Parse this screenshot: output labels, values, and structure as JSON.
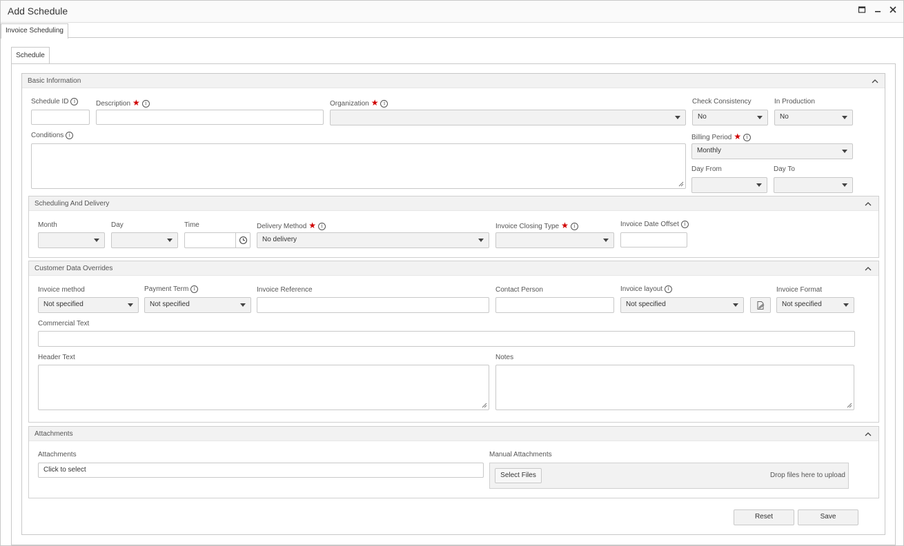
{
  "window": {
    "title": "Add Schedule"
  },
  "tabs": {
    "outer": "Invoice Scheduling",
    "inner": "Schedule"
  },
  "basic": {
    "header": "Basic Information",
    "schedule_id_label": "Schedule ID",
    "description_label": "Description",
    "organization_label": "Organization",
    "check_consistency_label": "Check Consistency",
    "check_consistency_value": "No",
    "in_production_label": "In Production",
    "in_production_value": "No",
    "conditions_label": "Conditions",
    "billing_period_label": "Billing Period",
    "billing_period_value": "Monthly",
    "day_from_label": "Day From",
    "day_to_label": "Day To"
  },
  "scheduling": {
    "header": "Scheduling And Delivery",
    "month_label": "Month",
    "day_label": "Day",
    "time_label": "Time",
    "delivery_method_label": "Delivery Method",
    "delivery_method_value": "No delivery",
    "invoice_closing_type_label": "Invoice Closing Type",
    "invoice_date_offset_label": "Invoice Date Offset"
  },
  "overrides": {
    "header": "Customer Data Overrides",
    "invoice_method_label": "Invoice method",
    "invoice_method_value": "Not specified",
    "payment_term_label": "Payment Term",
    "payment_term_value": "Not specified",
    "invoice_reference_label": "Invoice Reference",
    "contact_person_label": "Contact Person",
    "invoice_layout_label": "Invoice layout",
    "invoice_layout_value": "Not specified",
    "invoice_format_label": "Invoice Format",
    "invoice_format_value": "Not specified",
    "commercial_text_label": "Commercial Text",
    "header_text_label": "Header Text",
    "notes_label": "Notes"
  },
  "attachments": {
    "header": "Attachments",
    "attachments_label": "Attachments",
    "attachments_placeholder": "Click to select",
    "manual_label": "Manual Attachments",
    "select_files": "Select Files",
    "drop_text": "Drop files here to upload"
  },
  "footer": {
    "reset": "Reset",
    "save": "Save"
  },
  "icons": {
    "info": "info-icon",
    "required": "required-asterisk-icon",
    "clock": "clock-icon",
    "edit": "edit-document-icon",
    "collapse": "chevron-up-icon"
  }
}
